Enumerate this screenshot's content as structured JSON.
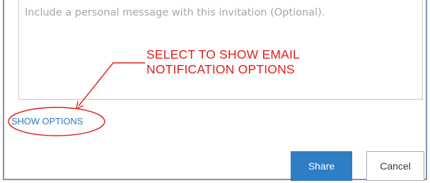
{
  "message": {
    "placeholder": "Include a personal message with this invitation (Optional).",
    "value": ""
  },
  "annotation": {
    "text": "SELECT TO SHOW EMAIL\nNOTIFICATION OPTIONS",
    "color": "#e0201b"
  },
  "options_link": {
    "label": "SHOW OPTIONS"
  },
  "actions": {
    "share_label": "Share",
    "cancel_label": "Cancel"
  },
  "colors": {
    "accent": "#2f7dc2",
    "link": "#2e7cc4",
    "frame_border": "#7f95b5"
  }
}
